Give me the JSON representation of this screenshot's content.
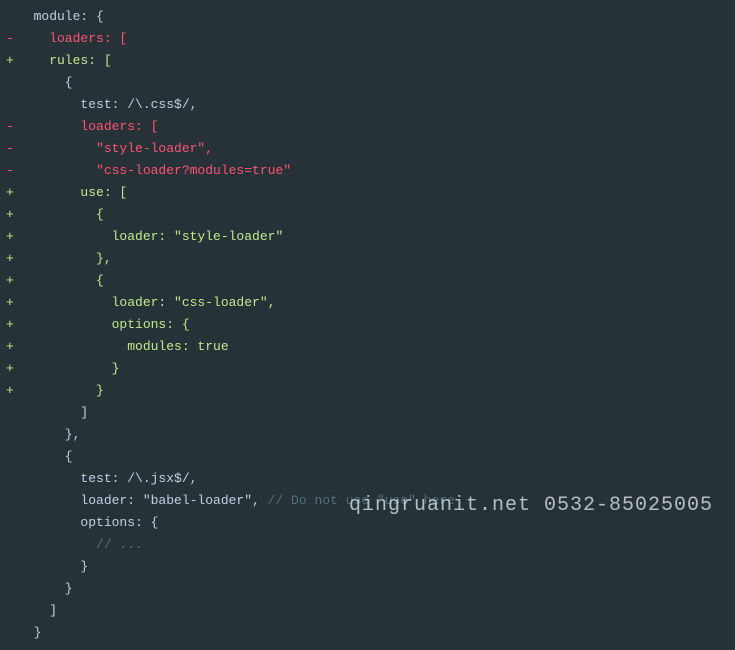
{
  "watermark": "qingruanit.net 0532-85025005",
  "lines": [
    {
      "type": "ctx",
      "text": "  module: {"
    },
    {
      "type": "del",
      "text": "    loaders: ["
    },
    {
      "type": "add",
      "text": "    rules: ["
    },
    {
      "type": "ctx",
      "text": "      {"
    },
    {
      "type": "ctx",
      "text": "        test: /\\.css$/,"
    },
    {
      "type": "del",
      "text": "        loaders: ["
    },
    {
      "type": "del",
      "text": "          \"style-loader\","
    },
    {
      "type": "del",
      "text": "          \"css-loader?modules=true\""
    },
    {
      "type": "add",
      "text": "        use: ["
    },
    {
      "type": "add",
      "text": "          {"
    },
    {
      "type": "add",
      "text": "            loader: \"style-loader\""
    },
    {
      "type": "add",
      "text": "          },"
    },
    {
      "type": "add",
      "text": "          {"
    },
    {
      "type": "add",
      "text": "            loader: \"css-loader\","
    },
    {
      "type": "add",
      "text": "            options: {"
    },
    {
      "type": "add",
      "text": "              modules: true"
    },
    {
      "type": "add",
      "text": "            }"
    },
    {
      "type": "add",
      "text": "          }"
    },
    {
      "type": "ctx",
      "text": "        ]"
    },
    {
      "type": "ctx",
      "text": "      },"
    },
    {
      "type": "ctx",
      "text": "      {"
    },
    {
      "type": "ctx",
      "text": "        test: /\\.jsx$/,"
    },
    {
      "type": "ctx",
      "text": "        loader: \"babel-loader\", ",
      "comment": "// Do not use \"use\" here"
    },
    {
      "type": "ctx",
      "text": "        options: {"
    },
    {
      "type": "ctx",
      "text": "          ",
      "comment": "// ..."
    },
    {
      "type": "ctx",
      "text": "        }"
    },
    {
      "type": "ctx",
      "text": "      }"
    },
    {
      "type": "ctx",
      "text": "    ]"
    },
    {
      "type": "ctx",
      "text": "  }"
    }
  ]
}
